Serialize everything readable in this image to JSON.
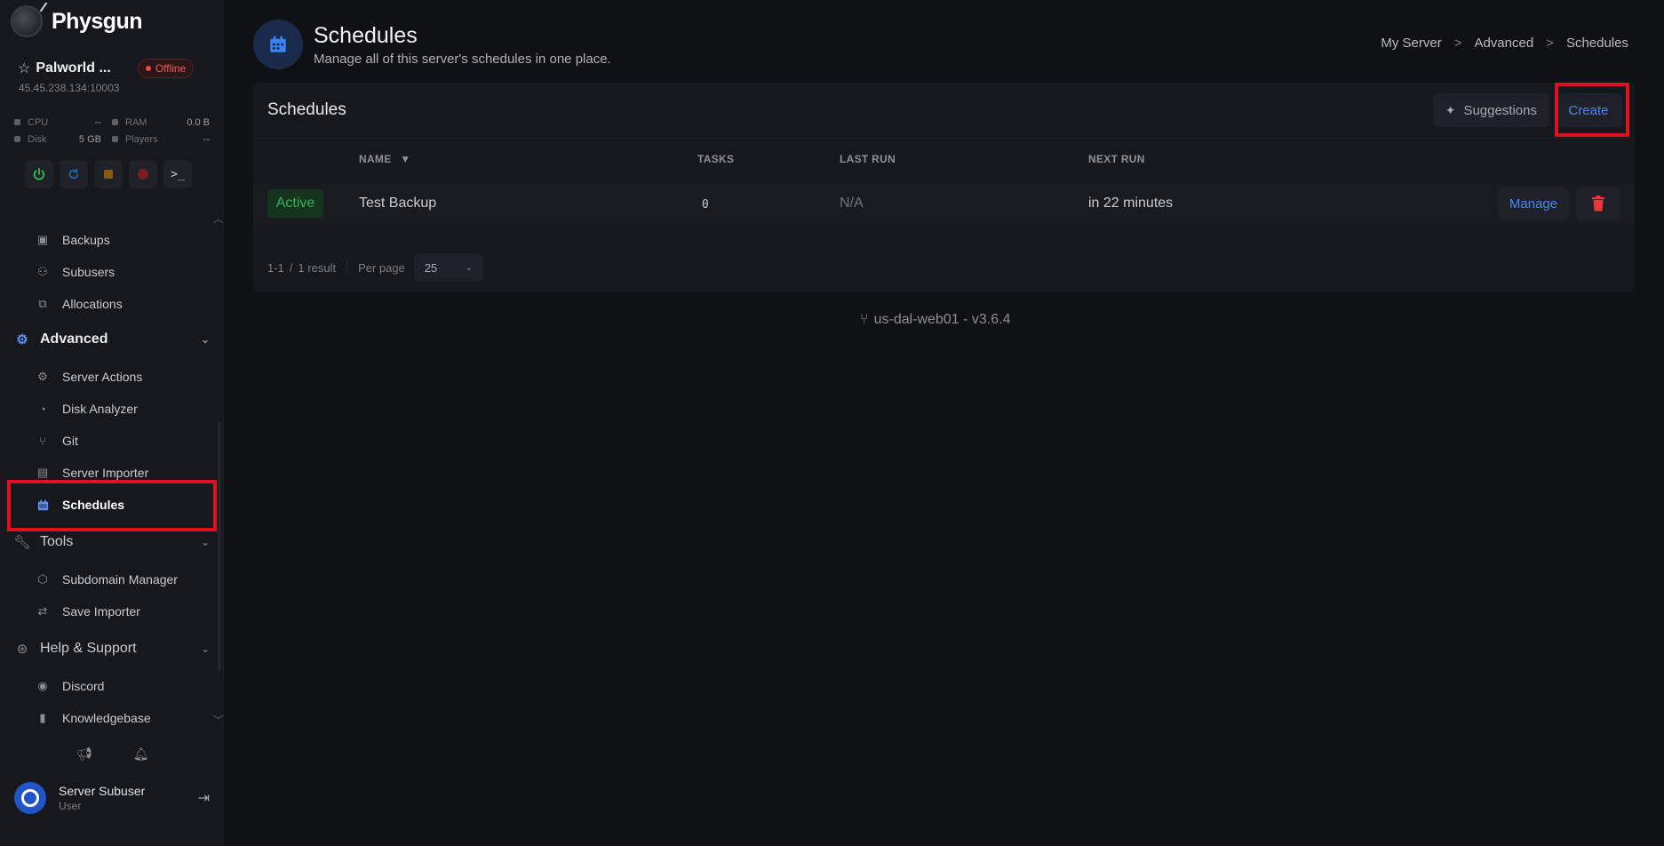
{
  "brand": {
    "name": "Physgun"
  },
  "server": {
    "name": "Palworld ...",
    "status": "Offline",
    "address": "45.45.238.134:10003",
    "stats": [
      {
        "label": "CPU",
        "value": "--"
      },
      {
        "label": "RAM",
        "value": "0.0 B"
      },
      {
        "label": "Disk",
        "value": "5 GB"
      },
      {
        "label": "Players",
        "value": "--"
      }
    ]
  },
  "sidebar": {
    "items": {
      "backups": "Backups",
      "subusers": "Subusers",
      "allocations": "Allocations",
      "advanced": "Advanced",
      "server_actions": "Server Actions",
      "disk_analyzer": "Disk Analyzer",
      "git": "Git",
      "server_importer": "Server Importer",
      "schedules": "Schedules",
      "tools": "Tools",
      "subdomain_manager": "Subdomain Manager",
      "save_importer": "Save Importer",
      "help_support": "Help & Support",
      "discord": "Discord",
      "knowledgebase": "Knowledgebase"
    }
  },
  "user": {
    "name": "Server Subuser",
    "role": "User"
  },
  "page": {
    "title": "Schedules",
    "subtitle": "Manage all of this server's schedules in one place.",
    "breadcrumb": [
      "My Server",
      "Advanced",
      "Schedules"
    ],
    "breadcrumb_sep": ">"
  },
  "card": {
    "title": "Schedules",
    "suggestions_label": "Suggestions",
    "create_label": "Create",
    "columns": {
      "name": "NAME",
      "tasks": "TASKS",
      "last_run": "LAST RUN",
      "next_run": "NEXT RUN"
    },
    "rows": [
      {
        "status": "Active",
        "name": "Test Backup",
        "tasks": "0",
        "last_run": "N/A",
        "next_run": "in 22 minutes",
        "manage_label": "Manage"
      }
    ],
    "footer": {
      "range": "1-1",
      "sep": "/",
      "result": "1 result",
      "per_page_label": "Per page",
      "per_page_value": "25"
    }
  },
  "version": "us-dal-web01 - v3.6.4",
  "colors": {
    "accent": "#4a86f2",
    "danger": "#e0101e",
    "success": "#31b45a",
    "offline": "#ef4444"
  }
}
